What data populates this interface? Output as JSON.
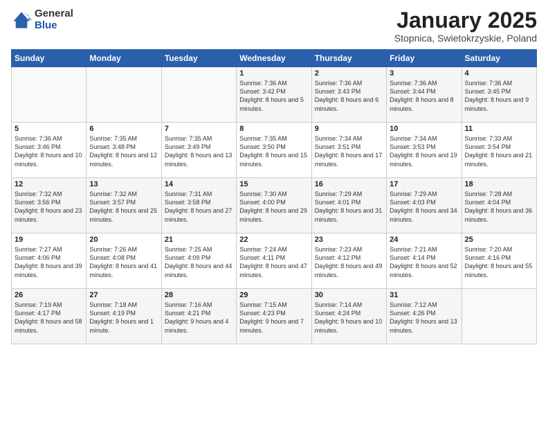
{
  "logo": {
    "general": "General",
    "blue": "Blue"
  },
  "title": "January 2025",
  "location": "Stopnica, Swietokrzyskie, Poland",
  "days_header": [
    "Sunday",
    "Monday",
    "Tuesday",
    "Wednesday",
    "Thursday",
    "Friday",
    "Saturday"
  ],
  "weeks": [
    [
      {
        "day": "",
        "info": ""
      },
      {
        "day": "",
        "info": ""
      },
      {
        "day": "",
        "info": ""
      },
      {
        "day": "1",
        "info": "Sunrise: 7:36 AM\nSunset: 3:42 PM\nDaylight: 8 hours\nand 5 minutes."
      },
      {
        "day": "2",
        "info": "Sunrise: 7:36 AM\nSunset: 3:43 PM\nDaylight: 8 hours\nand 6 minutes."
      },
      {
        "day": "3",
        "info": "Sunrise: 7:36 AM\nSunset: 3:44 PM\nDaylight: 8 hours\nand 8 minutes."
      },
      {
        "day": "4",
        "info": "Sunrise: 7:36 AM\nSunset: 3:45 PM\nDaylight: 8 hours\nand 9 minutes."
      }
    ],
    [
      {
        "day": "5",
        "info": "Sunrise: 7:36 AM\nSunset: 3:46 PM\nDaylight: 8 hours\nand 10 minutes."
      },
      {
        "day": "6",
        "info": "Sunrise: 7:35 AM\nSunset: 3:48 PM\nDaylight: 8 hours\nand 12 minutes."
      },
      {
        "day": "7",
        "info": "Sunrise: 7:35 AM\nSunset: 3:49 PM\nDaylight: 8 hours\nand 13 minutes."
      },
      {
        "day": "8",
        "info": "Sunrise: 7:35 AM\nSunset: 3:50 PM\nDaylight: 8 hours\nand 15 minutes."
      },
      {
        "day": "9",
        "info": "Sunrise: 7:34 AM\nSunset: 3:51 PM\nDaylight: 8 hours\nand 17 minutes."
      },
      {
        "day": "10",
        "info": "Sunrise: 7:34 AM\nSunset: 3:53 PM\nDaylight: 8 hours\nand 19 minutes."
      },
      {
        "day": "11",
        "info": "Sunrise: 7:33 AM\nSunset: 3:54 PM\nDaylight: 8 hours\nand 21 minutes."
      }
    ],
    [
      {
        "day": "12",
        "info": "Sunrise: 7:32 AM\nSunset: 3:56 PM\nDaylight: 8 hours\nand 23 minutes."
      },
      {
        "day": "13",
        "info": "Sunrise: 7:32 AM\nSunset: 3:57 PM\nDaylight: 8 hours\nand 25 minutes."
      },
      {
        "day": "14",
        "info": "Sunrise: 7:31 AM\nSunset: 3:58 PM\nDaylight: 8 hours\nand 27 minutes."
      },
      {
        "day": "15",
        "info": "Sunrise: 7:30 AM\nSunset: 4:00 PM\nDaylight: 8 hours\nand 29 minutes."
      },
      {
        "day": "16",
        "info": "Sunrise: 7:29 AM\nSunset: 4:01 PM\nDaylight: 8 hours\nand 31 minutes."
      },
      {
        "day": "17",
        "info": "Sunrise: 7:29 AM\nSunset: 4:03 PM\nDaylight: 8 hours\nand 34 minutes."
      },
      {
        "day": "18",
        "info": "Sunrise: 7:28 AM\nSunset: 4:04 PM\nDaylight: 8 hours\nand 36 minutes."
      }
    ],
    [
      {
        "day": "19",
        "info": "Sunrise: 7:27 AM\nSunset: 4:06 PM\nDaylight: 8 hours\nand 39 minutes."
      },
      {
        "day": "20",
        "info": "Sunrise: 7:26 AM\nSunset: 4:08 PM\nDaylight: 8 hours\nand 41 minutes."
      },
      {
        "day": "21",
        "info": "Sunrise: 7:25 AM\nSunset: 4:09 PM\nDaylight: 8 hours\nand 44 minutes."
      },
      {
        "day": "22",
        "info": "Sunrise: 7:24 AM\nSunset: 4:11 PM\nDaylight: 8 hours\nand 47 minutes."
      },
      {
        "day": "23",
        "info": "Sunrise: 7:23 AM\nSunset: 4:12 PM\nDaylight: 8 hours\nand 49 minutes."
      },
      {
        "day": "24",
        "info": "Sunrise: 7:21 AM\nSunset: 4:14 PM\nDaylight: 8 hours\nand 52 minutes."
      },
      {
        "day": "25",
        "info": "Sunrise: 7:20 AM\nSunset: 4:16 PM\nDaylight: 8 hours\nand 55 minutes."
      }
    ],
    [
      {
        "day": "26",
        "info": "Sunrise: 7:19 AM\nSunset: 4:17 PM\nDaylight: 8 hours\nand 58 minutes."
      },
      {
        "day": "27",
        "info": "Sunrise: 7:18 AM\nSunset: 4:19 PM\nDaylight: 9 hours\nand 1 minute."
      },
      {
        "day": "28",
        "info": "Sunrise: 7:16 AM\nSunset: 4:21 PM\nDaylight: 9 hours\nand 4 minutes."
      },
      {
        "day": "29",
        "info": "Sunrise: 7:15 AM\nSunset: 4:23 PM\nDaylight: 9 hours\nand 7 minutes."
      },
      {
        "day": "30",
        "info": "Sunrise: 7:14 AM\nSunset: 4:24 PM\nDaylight: 9 hours\nand 10 minutes."
      },
      {
        "day": "31",
        "info": "Sunrise: 7:12 AM\nSunset: 4:26 PM\nDaylight: 9 hours\nand 13 minutes."
      },
      {
        "day": "",
        "info": ""
      }
    ]
  ]
}
